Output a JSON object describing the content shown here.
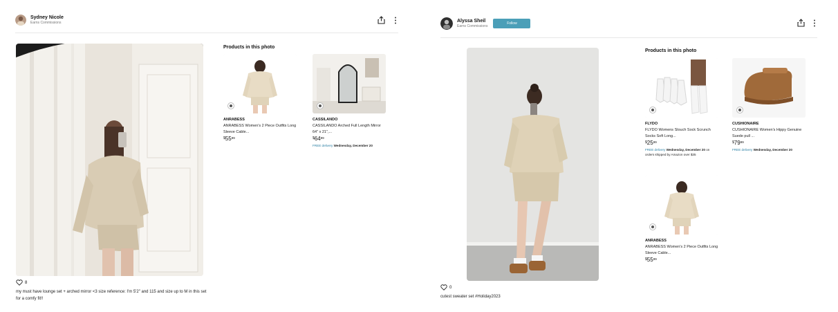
{
  "left_post": {
    "author": {
      "name": "Sydney Nicole",
      "subtitle": "Earns Commissions"
    },
    "likes": "8",
    "caption": "my must have lounge set + arched mirror <3 size reference: I'm 5'2\" and 115 and size up to M in this set for a comfy fit!!",
    "products_title": "Products in this photo",
    "products": [
      {
        "brand": "ANRABESS",
        "title": "ANRABESS Women's 2 Piece Outfits Long Sleeve Cable...",
        "price_symbol": "$",
        "price_whole": "55",
        "price_cents": "99"
      },
      {
        "brand": "CASSILANDO",
        "title": "CASSILANDO Arched Full Length Mirror 64\" x 21\",...",
        "price_symbol": "$",
        "price_whole": "64",
        "price_cents": "99",
        "delivery": {
          "free": "FREE delivery",
          "date": "Wednesday, December 20"
        }
      }
    ]
  },
  "right_post": {
    "author": {
      "name": "Alyssa Sheil",
      "subtitle": "Earns Commissions"
    },
    "follow_label": "Follow",
    "likes": "0",
    "caption": "cutest sweater set #Holiday2023",
    "products_title": "Products in this photo",
    "products": [
      {
        "brand": "FLYDO",
        "title": "FLYDO Womens Slouch Sock Scrunch Socks Soft Long...",
        "price_symbol": "$",
        "price_whole": "25",
        "price_cents": "99",
        "delivery": {
          "free": "FREE delivery",
          "date": "Wednesday, December 20",
          "suffix": "on orders shipped by Amazon over $35"
        }
      },
      {
        "brand": "CUSHIONAIRE",
        "title": "CUSHIONAIRE Women's Hippy Genuine Suede pull ...",
        "price_symbol": "$",
        "price_whole": "79",
        "price_cents": "99",
        "delivery": {
          "free": "FREE delivery",
          "date": "Wednesday, December 20"
        }
      },
      {
        "brand": "ANRABESS",
        "title": "ANRABESS Women's 2 Piece Outfits Long Sleeve Cable...",
        "price_symbol": "$",
        "price_whole": "55",
        "price_cents": "99"
      }
    ]
  },
  "icons": {
    "share": "share-icon",
    "more": "more-options-icon",
    "heart": "heart-icon",
    "badge": "shop-badge-icon"
  },
  "colors": {
    "follow_button": "#4b9fb8",
    "free_delivery": "#2a7fa3",
    "divider": "#e7e7e7"
  }
}
